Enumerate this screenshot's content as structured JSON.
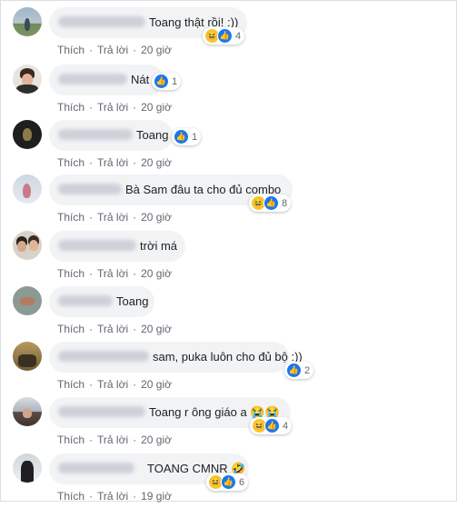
{
  "ui": {
    "like_label": "Thích",
    "reply_label": "Trả lời",
    "separator": "·",
    "colors": {
      "bubble": "#f2f3f5",
      "text": "#1c1e21",
      "meta": "#606770",
      "like": "#1877f2",
      "haha": "#f7c531"
    }
  },
  "comments": [
    {
      "text": "Toang thật rồi! :))",
      "reactions": [
        "haha-icon",
        "like-icon"
      ],
      "count": "4",
      "time": "20 giờ"
    },
    {
      "text": "Nát",
      "reactions": [
        "like-icon"
      ],
      "count": "1",
      "time": "20 giờ"
    },
    {
      "text": "Toang",
      "reactions": [
        "like-icon"
      ],
      "count": "1",
      "time": "20 giờ"
    },
    {
      "text": "Bà Sam đâu ta cho đủ combo",
      "reactions": [
        "haha-icon",
        "like-icon"
      ],
      "count": "8",
      "time": "20 giờ"
    },
    {
      "text": "trời má",
      "reactions": [],
      "count": "",
      "time": "20 giờ"
    },
    {
      "text": "Toang",
      "reactions": [],
      "count": "",
      "time": "20 giờ"
    },
    {
      "text": "sam, puka luôn cho đủ bộ :))",
      "reactions": [
        "like-icon"
      ],
      "count": "2",
      "time": "20 giờ"
    },
    {
      "text": "Toang r ông giáo a 😭😭",
      "reactions": [
        "haha-icon",
        "like-icon"
      ],
      "count": "4",
      "time": "20 giờ"
    },
    {
      "text": "TOANG CMNR 🤣",
      "reactions": [
        "haha-icon",
        "like-icon"
      ],
      "count": "6",
      "time": "19 giờ"
    }
  ]
}
